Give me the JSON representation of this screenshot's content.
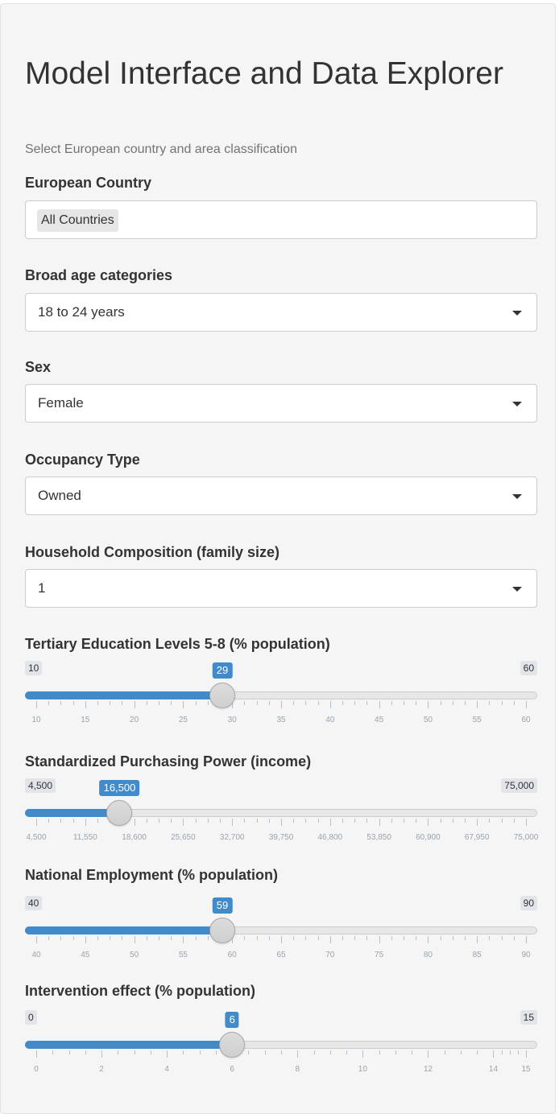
{
  "title": "Model Interface and Data Explorer",
  "subtitle": "Select European country and area classification",
  "country": {
    "label": "European Country",
    "value": "All Countries"
  },
  "age": {
    "label": "Broad age categories",
    "value": "18 to 24 years"
  },
  "sex": {
    "label": "Sex",
    "value": "Female"
  },
  "occupancy": {
    "label": "Occupancy Type",
    "value": "Owned"
  },
  "household": {
    "label": "Household Composition (family size)",
    "value": "1"
  },
  "sliders": [
    {
      "label": "Tertiary Education Levels 5-8 (% population)",
      "min": 10,
      "max": 60,
      "value": 29,
      "min_label": "10",
      "max_label": "60",
      "value_label": "29",
      "ticks": [
        "10",
        "15",
        "20",
        "25",
        "30",
        "35",
        "40",
        "45",
        "50",
        "55",
        "60"
      ],
      "tick_values": [
        10,
        15,
        20,
        25,
        30,
        35,
        40,
        45,
        50,
        55,
        60
      ]
    },
    {
      "label": "Standardized Purchasing Power (income)",
      "min": 4500,
      "max": 75000,
      "value": 16500,
      "min_label": "4,500",
      "max_label": "75,000",
      "value_label": "16,500",
      "ticks": [
        "4,500",
        "11,550",
        "18,600",
        "25,650",
        "32,700",
        "39,750",
        "46,800",
        "53,850",
        "60,900",
        "67,950",
        "75,000"
      ],
      "tick_values": [
        4500,
        11550,
        18600,
        25650,
        32700,
        39750,
        46800,
        53850,
        60900,
        67950,
        75000
      ]
    },
    {
      "label": "National Employment (% population)",
      "min": 40,
      "max": 90,
      "value": 59,
      "min_label": "40",
      "max_label": "90",
      "value_label": "59",
      "ticks": [
        "40",
        "45",
        "50",
        "55",
        "60",
        "65",
        "70",
        "75",
        "80",
        "85",
        "90"
      ],
      "tick_values": [
        40,
        45,
        50,
        55,
        60,
        65,
        70,
        75,
        80,
        85,
        90
      ]
    },
    {
      "label": "Intervention effect (% population)",
      "min": 0,
      "max": 15,
      "value": 6,
      "min_label": "0",
      "max_label": "15",
      "value_label": "6",
      "ticks": [
        "0",
        "2",
        "4",
        "6",
        "8",
        "10",
        "12",
        "14",
        "15"
      ],
      "tick_values": [
        0,
        2,
        4,
        6,
        8,
        10,
        12,
        14,
        15
      ]
    }
  ],
  "colors": {
    "accent": "#428bca",
    "panel": "#f5f5f5"
  }
}
